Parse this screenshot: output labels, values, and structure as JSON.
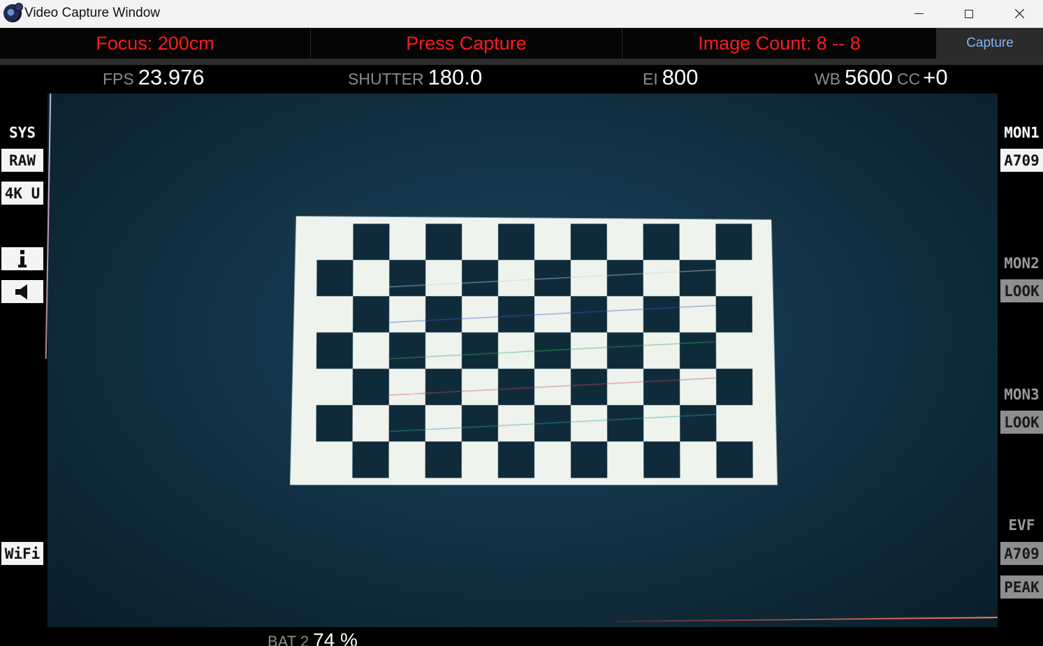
{
  "window": {
    "title": "Video Capture Window",
    "controls": {
      "minimize": "minimize-icon",
      "maximize": "maximize-icon",
      "close": "close-icon"
    }
  },
  "status": {
    "focus": "Focus: 200cm",
    "message": "Press Capture",
    "image_count": "Image Count: 8 -- 8",
    "capture_button": "Capture",
    "text_color": "#ff1a1a",
    "button_text_color": "#7fb3ff"
  },
  "hud": {
    "fps_label": "FPS",
    "fps_value": "23.976",
    "shutter_label": "SHUTTER",
    "shutter_value": "180.0",
    "ei_label": "EI",
    "ei_value": "800",
    "wb_label": "WB",
    "wb_value": "5600",
    "cc_label": "CC",
    "cc_value": "+0",
    "bat_label": "BAT 2",
    "bat_value": "74 %"
  },
  "left_panel": {
    "sys_label": "SYS",
    "raw": "RAW",
    "resolution": "4K U",
    "info_icon": "info-icon",
    "speaker_icon": "speaker-icon",
    "wifi": "WiFi"
  },
  "right_panel": {
    "mon1_label": "MON1",
    "mon1_value": "A709",
    "mon2_label": "MON2",
    "mon2_value": "LOOK",
    "mon3_label": "MON3",
    "mon3_value": "LOOK",
    "evf_label": "EVF",
    "evf_value": "A709",
    "evf_peak": "PEAK"
  },
  "checkerboard": {
    "rows": 7,
    "cols": 12,
    "square_color": "#0f2b3a",
    "paper_color": "#eef3ee"
  }
}
